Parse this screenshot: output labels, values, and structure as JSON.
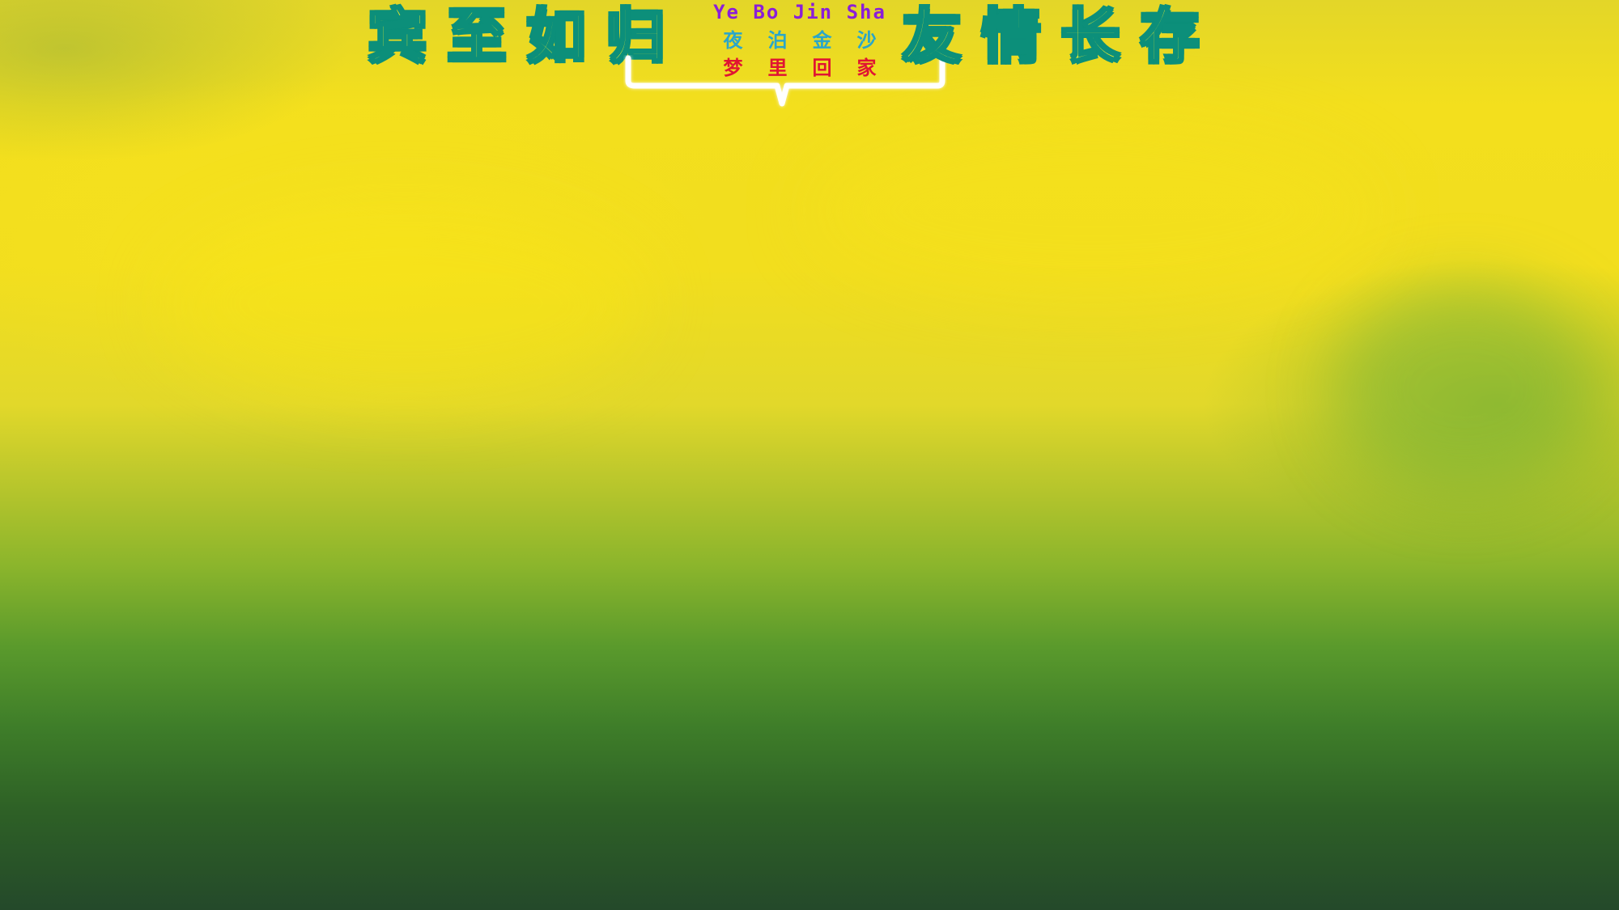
{
  "title_left": [
    "宾",
    "至",
    "如",
    "归"
  ],
  "title_right": [
    "友",
    "情",
    "长",
    "存"
  ],
  "pinyin": "Ye Bo Jin Sha",
  "line1": [
    "夜",
    "泊",
    "金",
    "沙"
  ],
  "line2": [
    "梦",
    "里",
    "回",
    "家"
  ],
  "colors": {
    "title_fill": "#f6ef2a",
    "title_stroke": "#0c8f7a",
    "pinyin": "#8a1ed8",
    "line1": "#2aa6c9",
    "line2": "#e01432",
    "brace": "#ffffff"
  }
}
